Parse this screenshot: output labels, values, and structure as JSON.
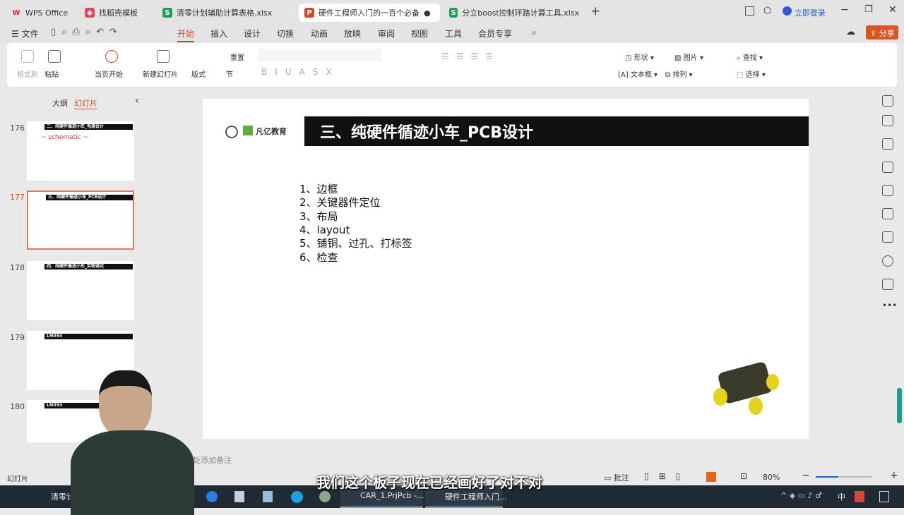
{
  "tabs": [
    {
      "label": "WPS Office",
      "icon": "wps-icon",
      "color": "#d9282f"
    },
    {
      "label": "找稻壳模板",
      "icon": "docer-icon",
      "color": "#e8455a"
    },
    {
      "label": "清零计划辅助计算表格.xlsx",
      "icon": "S",
      "color": "#1f9e57"
    },
    {
      "label": "硬件工程师入门的一百个必备",
      "icon": "P",
      "color": "#d24726"
    },
    {
      "label": "分立boost控制环路计算工具.xlsx",
      "icon": "S",
      "color": "#1f9e57"
    }
  ],
  "login": "立即登录",
  "menu": {
    "file": "文件",
    "items": [
      "开始",
      "插入",
      "设计",
      "切换",
      "动画",
      "放映",
      "审阅",
      "视图",
      "工具",
      "会员专享"
    ],
    "share": "分享"
  },
  "ribbon": {
    "format_painter": "格式刷",
    "paste": "粘贴",
    "play_current": "当页开始",
    "new_slide": "新建幻灯片",
    "layout": "版式",
    "section": "节",
    "reset": "重置",
    "shape": "形状",
    "picture": "图片",
    "textbox": "文本框",
    "arrange": "排列",
    "find": "查找",
    "select": "选择"
  },
  "panel": {
    "tab_outline": "大纲",
    "tab_slides": "幻灯片",
    "slides": [
      {
        "num": "176",
        "title": "二、纯硬件循迹小车_电源设计"
      },
      {
        "num": "177",
        "title": "三、纯硬件循迹小车_PCB设计"
      },
      {
        "num": "178",
        "title": "四、纯硬件循迹小车_实物调试"
      },
      {
        "num": "179",
        "title": "LM393"
      },
      {
        "num": "180",
        "title": "LM393"
      }
    ]
  },
  "slide": {
    "logo": "凡亿教育",
    "title": "三、纯硬件循迹小车_PCB设计",
    "items": [
      "1、边框",
      "2、关键器件定位",
      "3、布局",
      "4、layout",
      "5、铺铜、过孔、打标签",
      "6、检查"
    ]
  },
  "notes_placeholder": "单击此处添加备注",
  "status": {
    "slide_label": "幻灯片",
    "comment": "批注",
    "zoom": "80%"
  },
  "subtitle": "我们这个板子现在已经画好了对不对",
  "taskbar": {
    "item1": "清零计划",
    "item2": "CAR_1.PrjPcb -...",
    "item3": "硬件工程师入门...",
    "ime": "中"
  }
}
